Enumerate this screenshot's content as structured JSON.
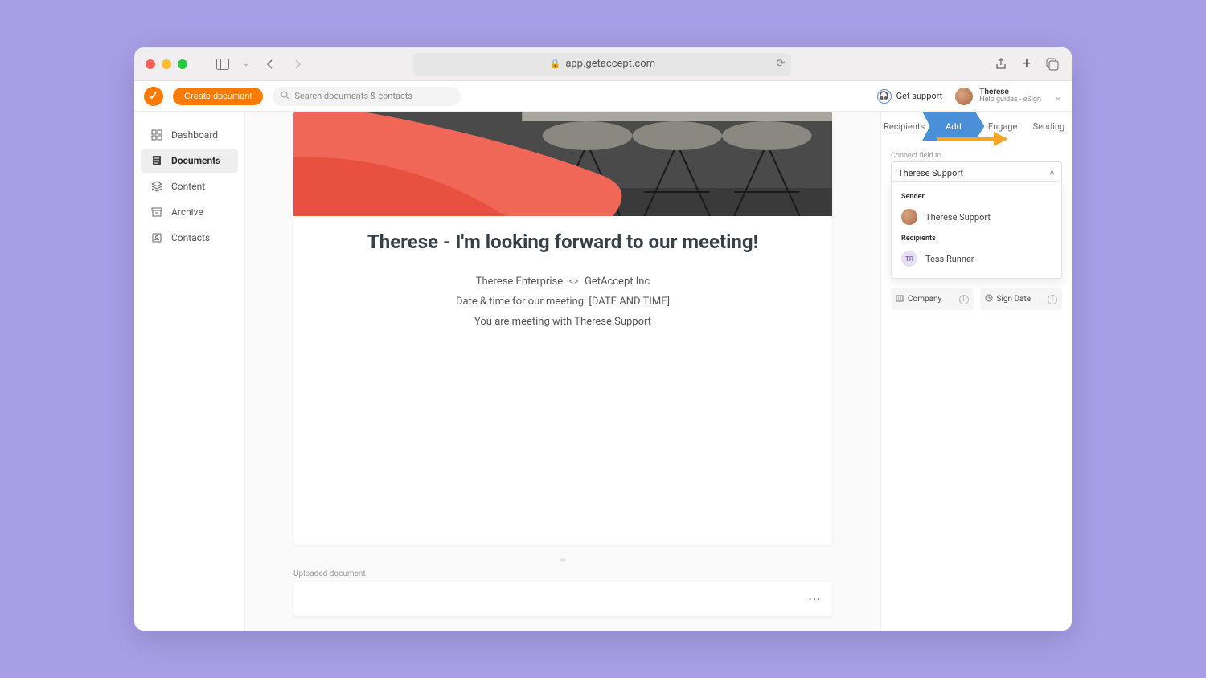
{
  "browser": {
    "url": "app.getaccept.com"
  },
  "topbar": {
    "create_label": "Create document",
    "search_placeholder": "Search documents & contacts",
    "support_label": "Get support",
    "user_name": "Therese",
    "user_sub": "Help guides - eSign"
  },
  "sidebar": {
    "items": [
      {
        "label": "Dashboard"
      },
      {
        "label": "Documents"
      },
      {
        "label": "Content"
      },
      {
        "label": "Archive"
      },
      {
        "label": "Contacts"
      }
    ]
  },
  "document": {
    "title": "Therese - I'm looking forward to our meeting!",
    "line1_left": "Therese Enterprise",
    "line1_right": "GetAccept Inc",
    "line2": "Date & time for our meeting: [DATE AND TIME]",
    "line3": "You are meeting with Therese Support",
    "uploaded_label": "Uploaded document"
  },
  "rightpanel": {
    "tabs": [
      "Recipients",
      "Add",
      "Engage",
      "Sending"
    ],
    "connect_label": "Connect field to",
    "connect_value": "Therese Support",
    "dropdown": {
      "sender_heading": "Sender",
      "sender_name": "Therese Support",
      "recipients_heading": "Recipients",
      "recipient_initials": "TR",
      "recipient_name": "Tess Runner"
    },
    "pill_company": "Company",
    "pill_signdate": "Sign Date"
  }
}
